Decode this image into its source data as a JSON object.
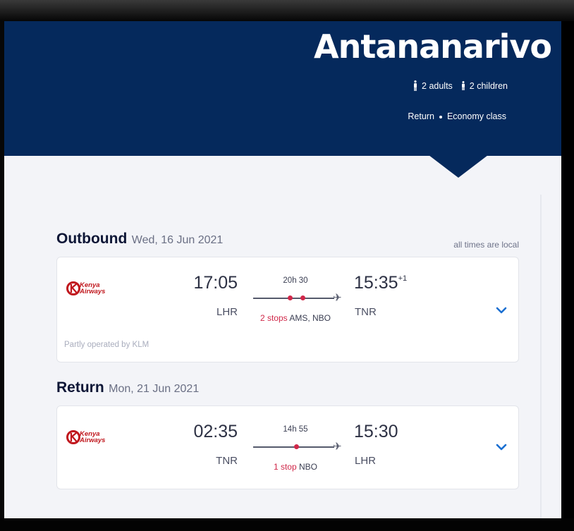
{
  "header": {
    "destination": "Antananarivo",
    "adults": "2 adults",
    "children": "2 children",
    "trip_type": "Return",
    "cabin_class": "Economy class"
  },
  "times_note": "all times are local",
  "outbound": {
    "heading": "Outbound",
    "date": "Wed, 16 Jun 2021",
    "airline": {
      "line1": "Kenya",
      "line2": "Airways"
    },
    "departure_time": "17:05",
    "departure_airport": "LHR",
    "duration": "20h 30",
    "stops_count": "2 stops",
    "stops_airports": "AMS, NBO",
    "arrival_time": "15:35",
    "arrival_day_offset": "+1",
    "arrival_airport": "TNR",
    "operated_by": "Partly operated by KLM"
  },
  "return": {
    "heading": "Return",
    "date": "Mon, 21 Jun 2021",
    "airline": {
      "line1": "Kenya",
      "line2": "Airways"
    },
    "departure_time": "02:35",
    "departure_airport": "TNR",
    "duration": "14h 55",
    "stops_count": "1 stop",
    "stops_airports": "NBO",
    "arrival_time": "15:30",
    "arrival_airport": "LHR"
  },
  "colors": {
    "hero": "#05295c",
    "stop_red": "#d02849",
    "chevron_blue": "#1a6fd1",
    "airline_red": "#c0171d"
  }
}
